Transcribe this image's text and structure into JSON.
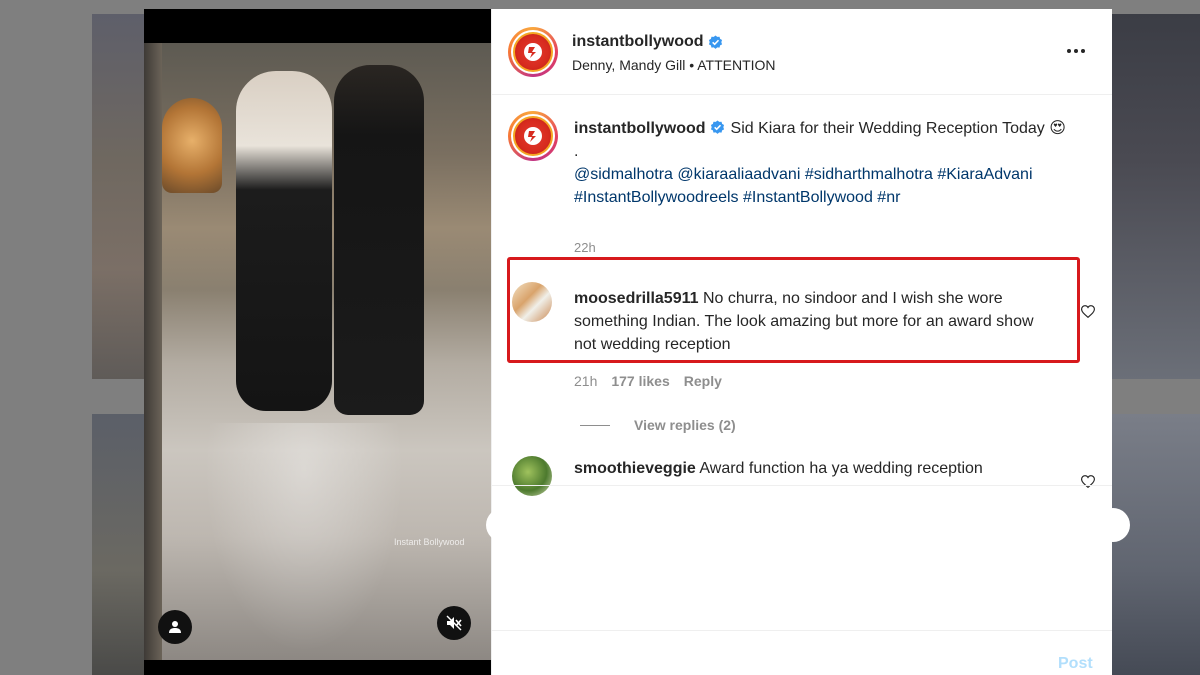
{
  "post": {
    "username": "instantbollywood",
    "audio": "Denny, Mandy Gill • ATTENTION",
    "avatar_logo_text": "Instant Bollywood",
    "video_watermark": "Instant Bollywood",
    "caption": {
      "text": "Sid Kiara for their Wedding Reception Today 😍",
      "dot": ".",
      "hashtags_line1": "@sidmalhotra @kiaraaliaadvani #sidharthmalhotra #KiaraAdvani",
      "hashtags_line2": "#InstantBollywoodreels #InstantBollywood #nr",
      "time": "22h"
    }
  },
  "comments": [
    {
      "username": "moosedrilla5911",
      "text": "No churra, no sindoor and I wish she wore something Indian. The look amazing but more for an award show not wedding reception",
      "time": "21h",
      "likes": "177 likes",
      "reply_label": "Reply",
      "view_replies": "View replies (2)"
    },
    {
      "username": "smoothieveggie",
      "text": "Award function ha ya wedding reception"
    }
  ],
  "add_comment": {
    "post_label": "Post"
  },
  "colors": {
    "verified": "#3897f0",
    "highlight": "#d7191c",
    "hashtag": "#00376b",
    "post_button": "#b2dffc"
  },
  "icons": {
    "verified": "verified-badge-icon",
    "more": "more-options-icon",
    "heart": "heart-icon",
    "user_tag": "user-tag-icon",
    "mute": "speaker-muted-icon"
  }
}
